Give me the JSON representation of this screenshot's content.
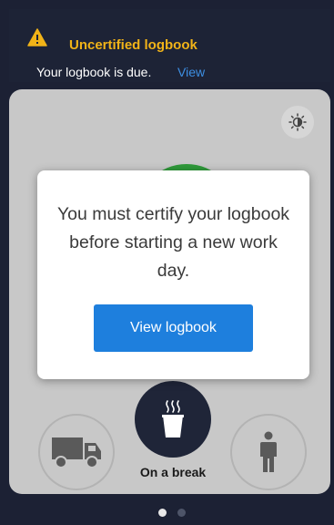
{
  "banner": {
    "title": "Uncertified logbook",
    "message": "Your logbook is due.",
    "link": "View",
    "icon": "warning-icon"
  },
  "status": {
    "current_label": "On a break",
    "buttons": [
      {
        "icon": "truck-icon"
      },
      {
        "icon": "coffee-cup-icon",
        "selected": true
      },
      {
        "icon": "person-icon"
      }
    ]
  },
  "modal": {
    "message": "You must certify your logbook before starting a new work day.",
    "button_label": "View logbook"
  },
  "pager": {
    "total": 2,
    "current": 1
  },
  "colors": {
    "accent": "#1e7fdd",
    "warning": "#f1b318",
    "dark_bg": "#1c2134",
    "on_duty_green": "#2f9a3a"
  }
}
